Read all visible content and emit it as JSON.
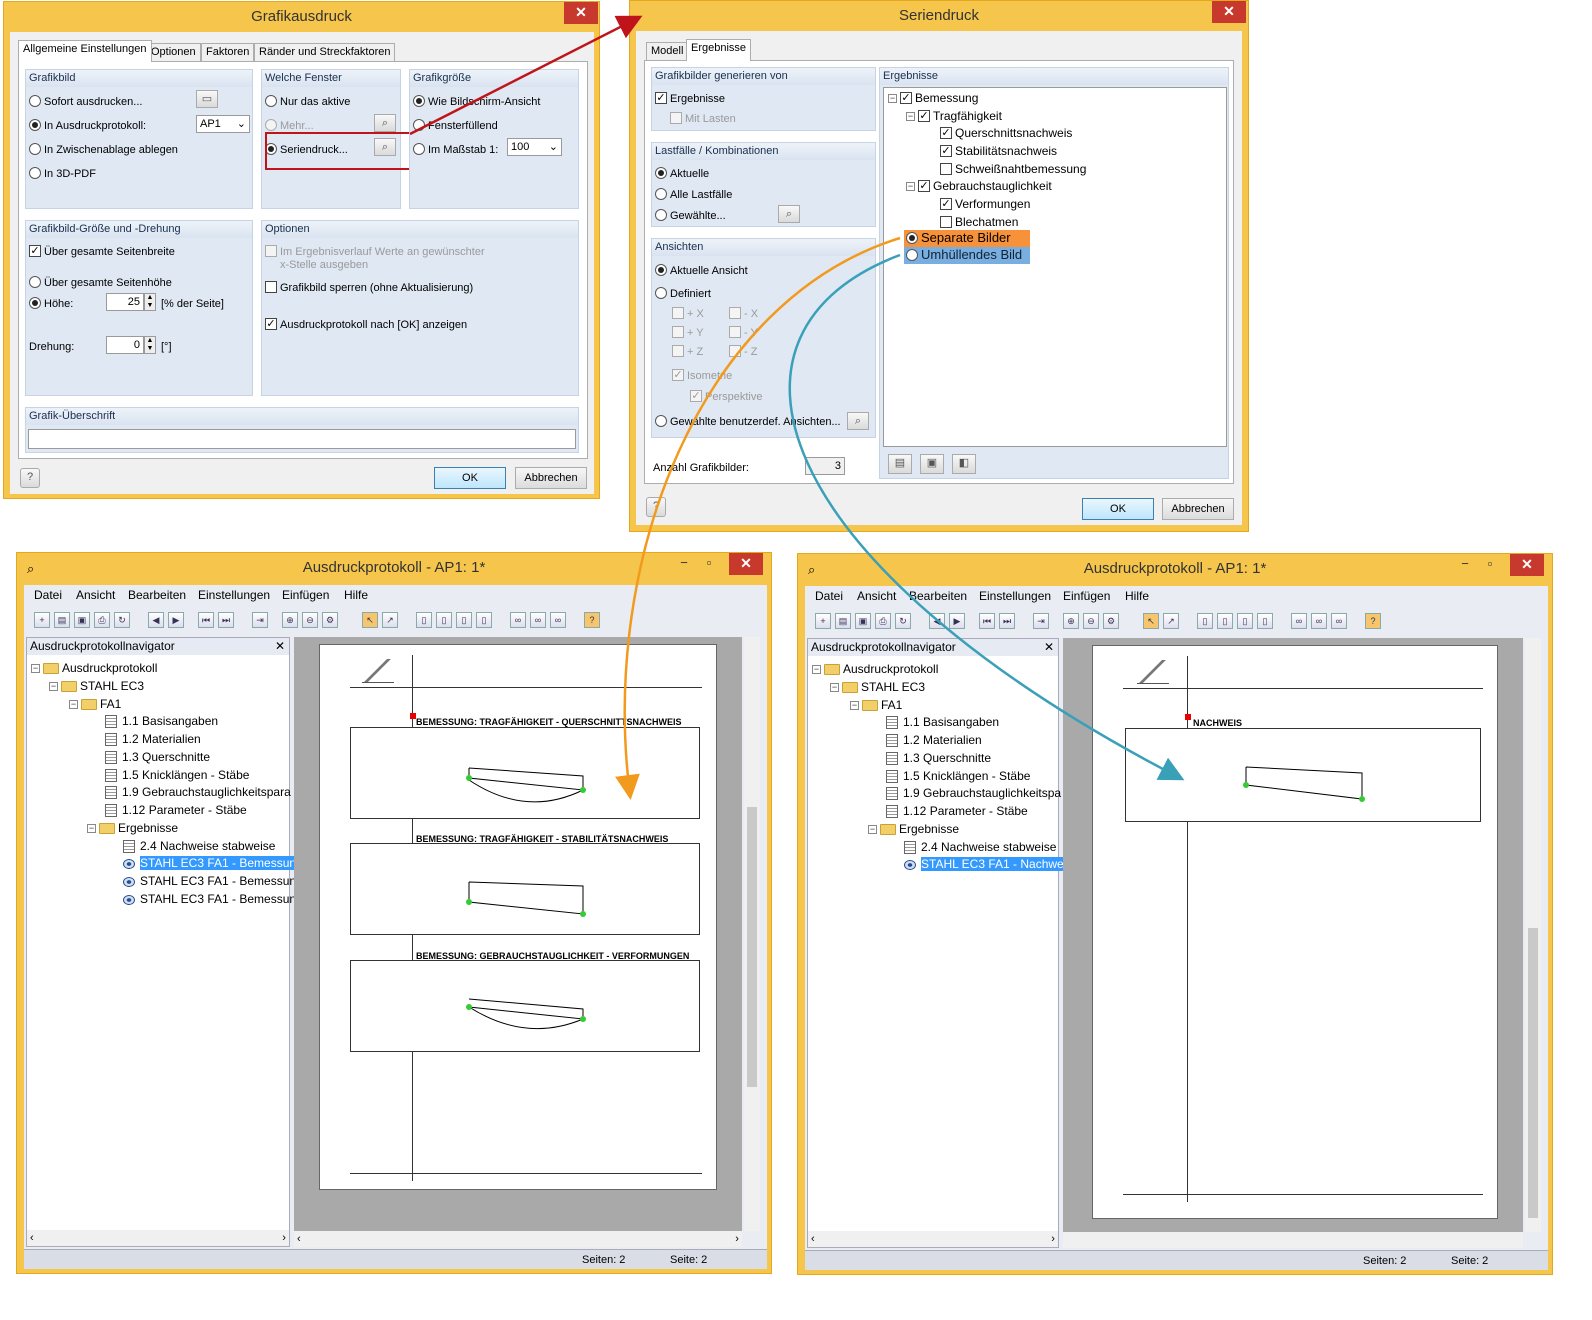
{
  "grafikausdruck": {
    "title": "Grafikausdruck",
    "tabs": [
      "Allgemeine Einstellungen",
      "Optionen",
      "Faktoren",
      "Ränder und Streckfaktoren"
    ],
    "grafikbild": {
      "heading": "Grafikbild",
      "options": [
        "Sofort ausdrucken...",
        "In Ausdruckprotokoll:",
        "In Zwischenablage ablegen",
        "In 3D-PDF"
      ],
      "protocol_value": "AP1"
    },
    "fenster": {
      "heading": "Welche Fenster",
      "options": [
        "Nur das aktive",
        "Mehr...",
        "Seriendruck..."
      ]
    },
    "groesse": {
      "heading": "Grafikgröße",
      "options": [
        "Wie Bildschirm-Ansicht",
        "Fensterfüllend",
        "Im Maßstab 1:"
      ],
      "scale_value": "100"
    },
    "drehung": {
      "heading": "Grafikbild-Größe und -Drehung",
      "opt1": "Über gesamte Seitenbreite",
      "opt2": "Über gesamte Seitenhöhe",
      "hoehe_label": "Höhe:",
      "hoehe_value": "25",
      "hoehe_unit": "[% der Seite]",
      "drehung_label": "Drehung:",
      "drehung_value": "0",
      "drehung_unit": "[°]"
    },
    "optionen": {
      "heading": "Optionen",
      "opt1_line1": "Im Ergebnisverlauf Werte an gewünschter",
      "opt1_line2": "x-Stelle ausgeben",
      "opt2": "Grafikbild sperren (ohne Aktualisierung)",
      "opt3": "Ausdruckprotokoll nach [OK] anzeigen"
    },
    "ueberschrift": {
      "heading": "Grafik-Überschrift",
      "value": ""
    },
    "ok": "OK",
    "cancel": "Abbrechen"
  },
  "seriendruck": {
    "title": "Seriendruck",
    "tabs": [
      "Modell",
      "Ergebnisse"
    ],
    "generieren": {
      "heading": "Grafikbilder generieren von",
      "opt1": "Ergebnisse",
      "opt2": "Mit Lasten"
    },
    "lastfaelle": {
      "heading": "Lastfälle / Kombinationen",
      "options": [
        "Aktuelle",
        "Alle Lastfälle",
        "Gewählte..."
      ]
    },
    "ansichten": {
      "heading": "Ansichten",
      "opt1": "Aktuelle Ansicht",
      "opt2": "Definiert",
      "axes": [
        "+ X",
        "- X",
        "+ Y",
        "- Y",
        "+ Z",
        "- Z"
      ],
      "iso": "Isometrie",
      "persp": "Perspektive",
      "opt3": "Gewählte benutzerdef. Ansichten..."
    },
    "ergebnisse": {
      "heading": "Ergebnisse",
      "tree": [
        "Bemessung",
        "Tragfähigkeit",
        "Querschnittsnachweis",
        "Stabilitätsnachweis",
        "Schweißnahtbemessung",
        "Gebrauchstauglichkeit",
        "Verformungen",
        "Blechatmen"
      ],
      "separate": "Separate Bilder",
      "umhuellend": "Umhüllendes Bild"
    },
    "anzahl_label": "Anzahl Grafikbilder:",
    "anzahl_value": "3",
    "ok": "OK",
    "cancel": "Abbrechen"
  },
  "protocol_left": {
    "title": "Ausdruckprotokoll - AP1: 1*",
    "menu": [
      "Datei",
      "Ansicht",
      "Bearbeiten",
      "Einstellungen",
      "Einfügen",
      "Hilfe"
    ],
    "navigator": "Ausdruckprotokollnavigator",
    "tree": [
      "Ausdruckprotokoll",
      "STAHL EC3",
      "FA1",
      "1.1 Basisangaben",
      "1.2 Materialien",
      "1.3 Querschnitte",
      "1.5 Knicklängen - Stäbe",
      "1.9 Gebrauchstauglichkeitspara",
      "1.12 Parameter - Stäbe",
      "Ergebnisse",
      "2.4 Nachweise stabweise",
      "STAHL EC3 FA1 - Bemessun",
      "STAHL EC3 FA1 - Bemessun",
      "STAHL EC3 FA1 - Bemessun"
    ],
    "sections": [
      "BEMESSUNG: TRAGFÄHIGKEIT - QUERSCHNITTSNACHWEIS",
      "BEMESSUNG: TRAGFÄHIGKEIT - STABILITÄTSNACHWEIS",
      "BEMESSUNG: GEBRAUCHSTAUGLICHKEIT - VERFORMUNGEN"
    ],
    "pages": "Seiten: 2",
    "page": "Seite: 2"
  },
  "protocol_right": {
    "title": "Ausdruckprotokoll - AP1: 1*",
    "menu": [
      "Datei",
      "Ansicht",
      "Bearbeiten",
      "Einstellungen",
      "Einfügen",
      "Hilfe"
    ],
    "navigator": "Ausdruckprotokollnavigator",
    "tree": [
      "Ausdruckprotokoll",
      "STAHL EC3",
      "FA1",
      "1.1 Basisangaben",
      "1.2 Materialien",
      "1.3 Querschnitte",
      "1.5 Knicklängen - Stäbe",
      "1.9 Gebrauchstauglichkeitspa",
      "1.12 Parameter - Stäbe",
      "Ergebnisse",
      "2.4 Nachweise stabweise",
      "STAHL EC3 FA1 - Nachwe"
    ],
    "sections": [
      "NACHWEIS"
    ],
    "pages": "Seiten: 2",
    "page": "Seite: 2"
  },
  "colors": {
    "dialog_frame": "#f5c54c",
    "group_bg": "#dfe8f3",
    "separate": "#f7923a",
    "umhuellend": "#79aee0",
    "arrow_red": "#c0141b",
    "arrow_orange": "#f29a1d",
    "arrow_teal": "#3aa0b8",
    "selection": "#3399ff"
  }
}
